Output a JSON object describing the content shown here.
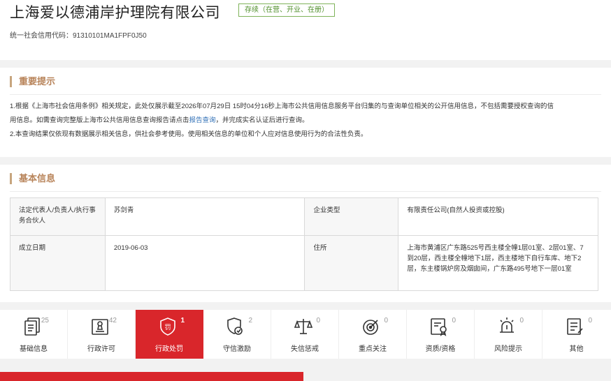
{
  "company": {
    "name": "上海爱以德浦岸护理院有限公司",
    "status": "存续（在营、开业、在册）",
    "credit_code": "统一社会信用代码：91310101MA1FPF0J50"
  },
  "notice": {
    "title": "重要提示",
    "line1_a": "1.根据《上海市社会信用条例》相关规定，此处仅展示截至2026年07月29日 15时04分16秒上海市公共信用信息服务平台归集的与查询单位相关的公开信用信息，不包括需要授权查询的信",
    "line1_b": "用信息。如需查询完整版上海市公共信用信息查询报告请点击",
    "link": "报告查询",
    "line1_c": "，并完成实名认证后进行查询。",
    "line2": "2.本查询结果仅依现有数据展示相关信息，供社会参考使用。使用相关信息的单位和个人应对信息使用行为的合法性负责。"
  },
  "basic": {
    "title": "基本信息",
    "rows": [
      {
        "label1": "法定代表人/负责人/执行事务合伙人",
        "value1": "苏剑青",
        "label2": "企业类型",
        "value2": "有限责任公司(自然人投资或控股)"
      },
      {
        "label1": "成立日期",
        "value1": "2019-06-03",
        "label2": "住所",
        "value2": "上海市黄浦区广东路525号西主楼全幢1层01室、2层01室、7到20层，西主楼全幢地下1层，西主楼地下自行车库、地下2层，东主楼锅炉房及烟囱间，广东路495号地下一层01室"
      }
    ]
  },
  "tabs": [
    {
      "label": "基础信息",
      "count": "25",
      "icon": "document-icon"
    },
    {
      "label": "行政许可",
      "count": "42",
      "icon": "stamp-icon"
    },
    {
      "label": "行政处罚",
      "count": "1",
      "icon": "penalty-shield-icon"
    },
    {
      "label": "守信激励",
      "count": "2",
      "icon": "shield-badge-icon"
    },
    {
      "label": "失信惩戒",
      "count": "0",
      "icon": "scales-icon"
    },
    {
      "label": "重点关注",
      "count": "0",
      "icon": "target-icon"
    },
    {
      "label": "资质/资格",
      "count": "0",
      "icon": "certificate-icon"
    },
    {
      "label": "风险提示",
      "count": "0",
      "icon": "alarm-icon"
    },
    {
      "label": "其他",
      "count": "0",
      "icon": "list-icon"
    }
  ],
  "colors": {
    "accent": "#d9262b",
    "title": "#b8845a",
    "status": "#4f8f2a",
    "link": "#2f6fb6"
  }
}
